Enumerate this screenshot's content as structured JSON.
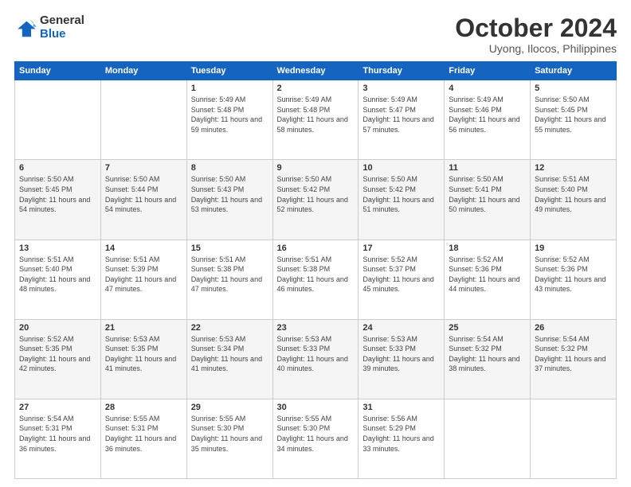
{
  "header": {
    "logo_general": "General",
    "logo_blue": "Blue",
    "month_title": "October 2024",
    "location": "Uyong, Ilocos, Philippines"
  },
  "weekdays": [
    "Sunday",
    "Monday",
    "Tuesday",
    "Wednesday",
    "Thursday",
    "Friday",
    "Saturday"
  ],
  "weeks": [
    [
      null,
      null,
      {
        "day": "1",
        "sunrise": "5:49 AM",
        "sunset": "5:48 PM",
        "daylight": "11 hours and 59 minutes."
      },
      {
        "day": "2",
        "sunrise": "5:49 AM",
        "sunset": "5:48 PM",
        "daylight": "11 hours and 58 minutes."
      },
      {
        "day": "3",
        "sunrise": "5:49 AM",
        "sunset": "5:47 PM",
        "daylight": "11 hours and 57 minutes."
      },
      {
        "day": "4",
        "sunrise": "5:49 AM",
        "sunset": "5:46 PM",
        "daylight": "11 hours and 56 minutes."
      },
      {
        "day": "5",
        "sunrise": "5:50 AM",
        "sunset": "5:45 PM",
        "daylight": "11 hours and 55 minutes."
      }
    ],
    [
      {
        "day": "6",
        "sunrise": "5:50 AM",
        "sunset": "5:45 PM",
        "daylight": "11 hours and 54 minutes."
      },
      {
        "day": "7",
        "sunrise": "5:50 AM",
        "sunset": "5:44 PM",
        "daylight": "11 hours and 54 minutes."
      },
      {
        "day": "8",
        "sunrise": "5:50 AM",
        "sunset": "5:43 PM",
        "daylight": "11 hours and 53 minutes."
      },
      {
        "day": "9",
        "sunrise": "5:50 AM",
        "sunset": "5:42 PM",
        "daylight": "11 hours and 52 minutes."
      },
      {
        "day": "10",
        "sunrise": "5:50 AM",
        "sunset": "5:42 PM",
        "daylight": "11 hours and 51 minutes."
      },
      {
        "day": "11",
        "sunrise": "5:50 AM",
        "sunset": "5:41 PM",
        "daylight": "11 hours and 50 minutes."
      },
      {
        "day": "12",
        "sunrise": "5:51 AM",
        "sunset": "5:40 PM",
        "daylight": "11 hours and 49 minutes."
      }
    ],
    [
      {
        "day": "13",
        "sunrise": "5:51 AM",
        "sunset": "5:40 PM",
        "daylight": "11 hours and 48 minutes."
      },
      {
        "day": "14",
        "sunrise": "5:51 AM",
        "sunset": "5:39 PM",
        "daylight": "11 hours and 47 minutes."
      },
      {
        "day": "15",
        "sunrise": "5:51 AM",
        "sunset": "5:38 PM",
        "daylight": "11 hours and 47 minutes."
      },
      {
        "day": "16",
        "sunrise": "5:51 AM",
        "sunset": "5:38 PM",
        "daylight": "11 hours and 46 minutes."
      },
      {
        "day": "17",
        "sunrise": "5:52 AM",
        "sunset": "5:37 PM",
        "daylight": "11 hours and 45 minutes."
      },
      {
        "day": "18",
        "sunrise": "5:52 AM",
        "sunset": "5:36 PM",
        "daylight": "11 hours and 44 minutes."
      },
      {
        "day": "19",
        "sunrise": "5:52 AM",
        "sunset": "5:36 PM",
        "daylight": "11 hours and 43 minutes."
      }
    ],
    [
      {
        "day": "20",
        "sunrise": "5:52 AM",
        "sunset": "5:35 PM",
        "daylight": "11 hours and 42 minutes."
      },
      {
        "day": "21",
        "sunrise": "5:53 AM",
        "sunset": "5:35 PM",
        "daylight": "11 hours and 41 minutes."
      },
      {
        "day": "22",
        "sunrise": "5:53 AM",
        "sunset": "5:34 PM",
        "daylight": "11 hours and 41 minutes."
      },
      {
        "day": "23",
        "sunrise": "5:53 AM",
        "sunset": "5:33 PM",
        "daylight": "11 hours and 40 minutes."
      },
      {
        "day": "24",
        "sunrise": "5:53 AM",
        "sunset": "5:33 PM",
        "daylight": "11 hours and 39 minutes."
      },
      {
        "day": "25",
        "sunrise": "5:54 AM",
        "sunset": "5:32 PM",
        "daylight": "11 hours and 38 minutes."
      },
      {
        "day": "26",
        "sunrise": "5:54 AM",
        "sunset": "5:32 PM",
        "daylight": "11 hours and 37 minutes."
      }
    ],
    [
      {
        "day": "27",
        "sunrise": "5:54 AM",
        "sunset": "5:31 PM",
        "daylight": "11 hours and 36 minutes."
      },
      {
        "day": "28",
        "sunrise": "5:55 AM",
        "sunset": "5:31 PM",
        "daylight": "11 hours and 36 minutes."
      },
      {
        "day": "29",
        "sunrise": "5:55 AM",
        "sunset": "5:30 PM",
        "daylight": "11 hours and 35 minutes."
      },
      {
        "day": "30",
        "sunrise": "5:55 AM",
        "sunset": "5:30 PM",
        "daylight": "11 hours and 34 minutes."
      },
      {
        "day": "31",
        "sunrise": "5:56 AM",
        "sunset": "5:29 PM",
        "daylight": "11 hours and 33 minutes."
      },
      null,
      null
    ]
  ]
}
